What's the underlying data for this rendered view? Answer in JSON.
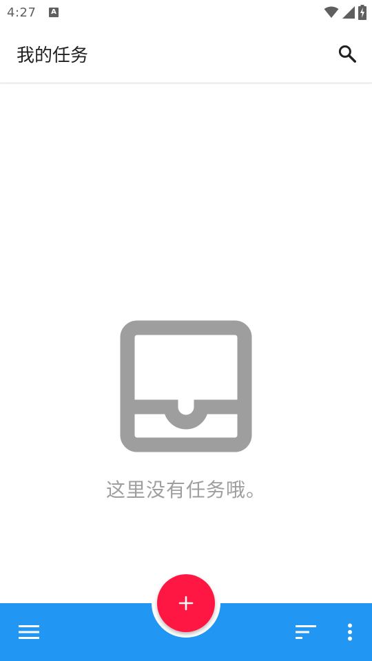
{
  "status_bar": {
    "time": "4:27",
    "notification_glyph": "A",
    "icons": [
      "wifi-icon",
      "cell-signal-icon",
      "battery-charging-icon"
    ]
  },
  "app_bar": {
    "title": "我的任务",
    "action_icon": "search-icon"
  },
  "empty_state": {
    "icon": "inbox-tray-icon",
    "message": "这里没有任务哦。"
  },
  "bottom_bar": {
    "left_icon": "menu-icon",
    "fab_icon": "plus-icon",
    "right_icons": [
      "sort-icon",
      "more-vert-icon"
    ]
  },
  "colors": {
    "bottom_bar": "#2196f3",
    "fab": "#ff1744",
    "empty_icon": "#9e9e9e",
    "empty_text": "#9e9e9e",
    "title_text": "#212121",
    "status_icons": "#5f5f5f"
  }
}
